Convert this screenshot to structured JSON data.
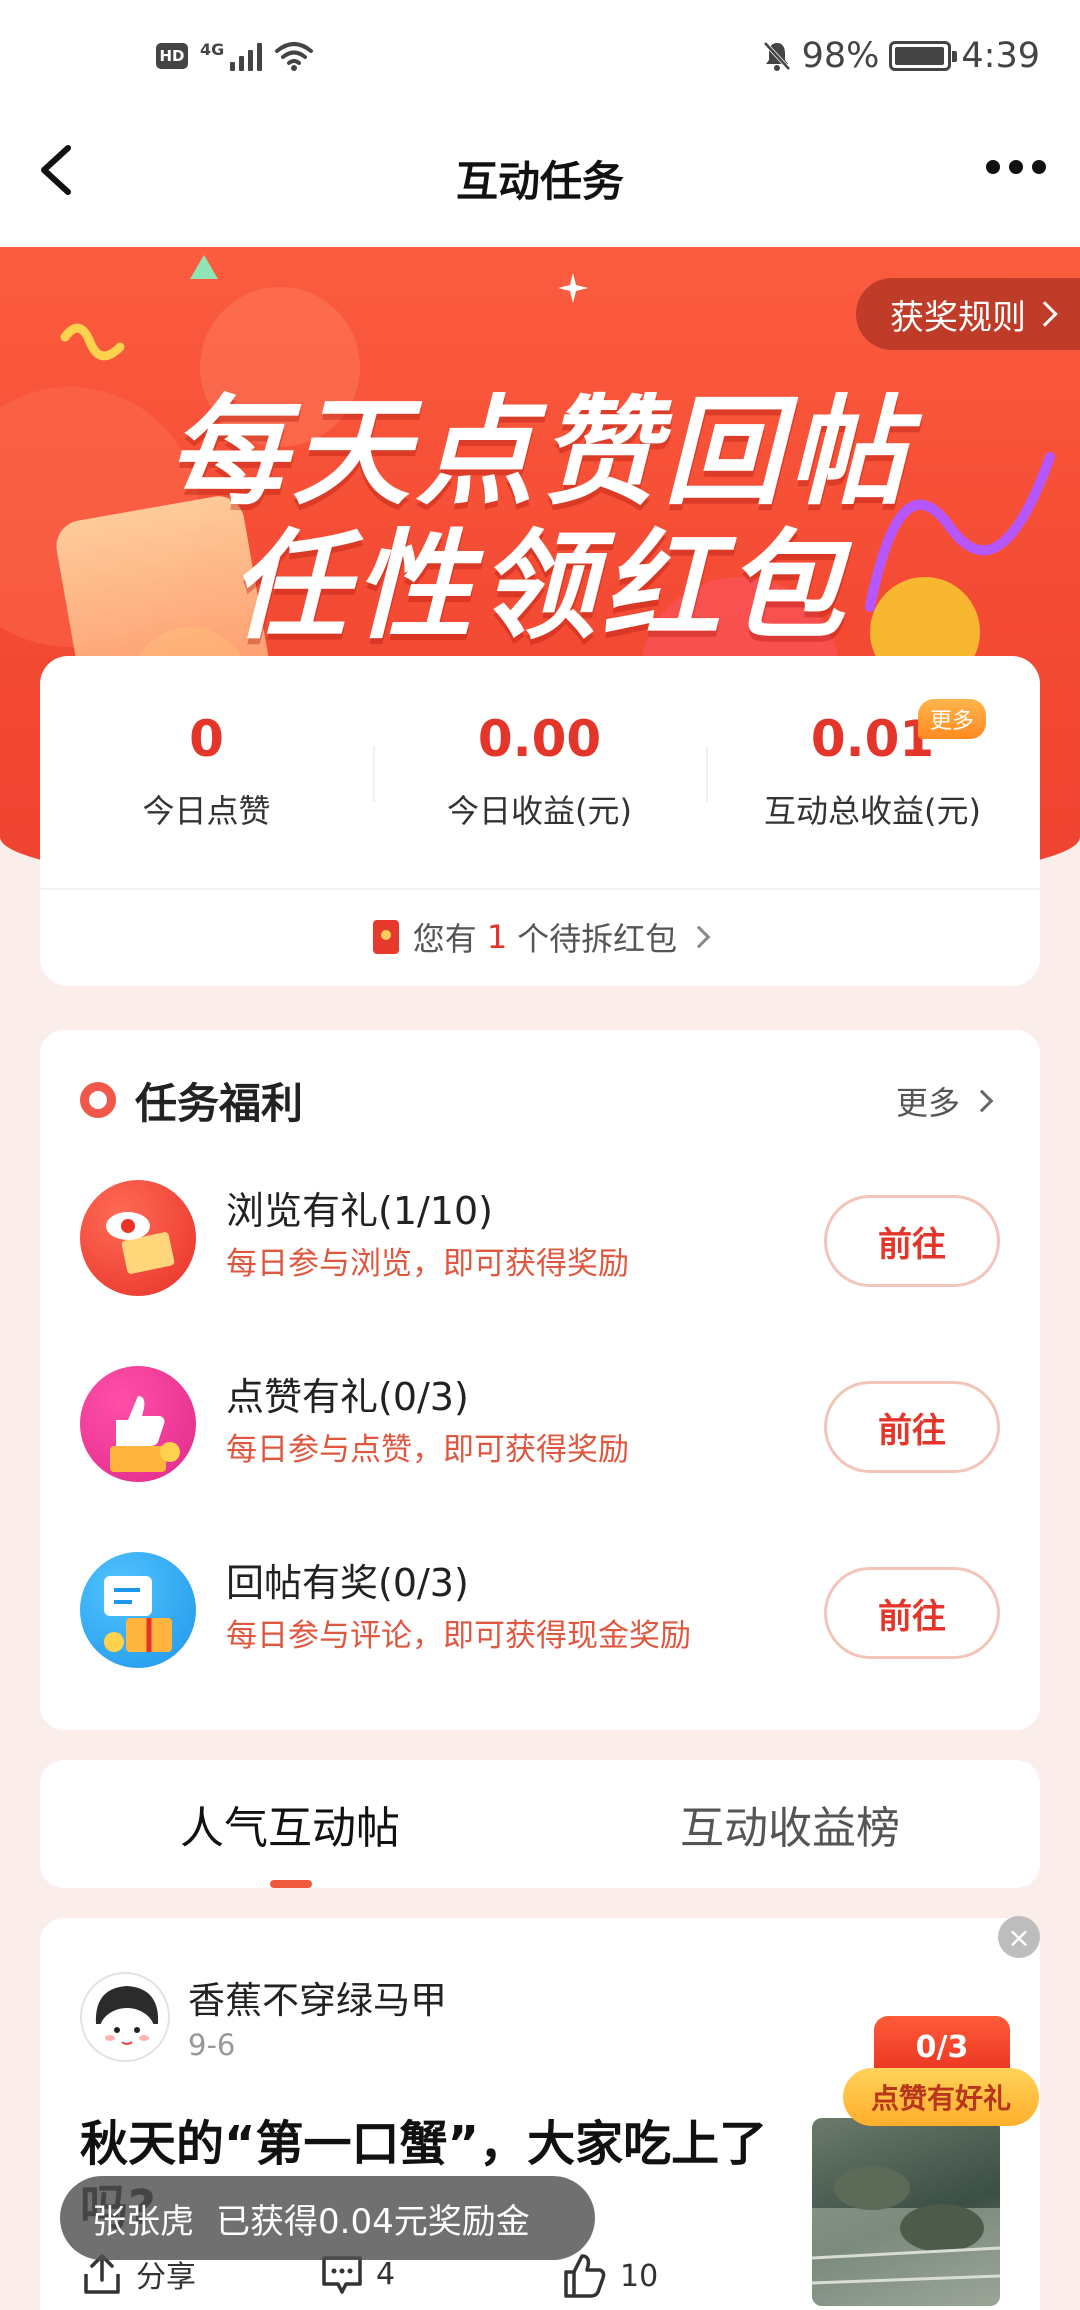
{
  "status_bar": {
    "hd": "HD",
    "network": "4G",
    "battery_percent": "98%",
    "time": "4:39"
  },
  "header": {
    "title": "互动任务"
  },
  "banner": {
    "rule_label": "获奖规则",
    "headline_line1": "每天点赞回帖",
    "headline_line2": "任性领红包"
  },
  "stats": {
    "items": [
      {
        "value": "0",
        "label": "今日点赞"
      },
      {
        "value": "0.00",
        "label": "今日收益(元)"
      },
      {
        "value": "0.01",
        "label": "互动总收益(元)"
      }
    ],
    "more_badge": "更多",
    "pending_prefix": "您有",
    "pending_count": "1",
    "pending_suffix": "个待拆红包"
  },
  "tasks": {
    "title": "任务福利",
    "more_label": "更多",
    "items": [
      {
        "name": "浏览有礼(1/10)",
        "desc": "每日参与浏览，即可获得奖励",
        "button": "前往",
        "icon": "eye-book-icon"
      },
      {
        "name": "点赞有礼(0/3)",
        "desc": "每日参与点赞，即可获得奖励",
        "button": "前往",
        "icon": "thumbs-up-gift-icon"
      },
      {
        "name": "回帖有奖(0/3)",
        "desc": "每日参与评论，即可获得现金奖励",
        "button": "前往",
        "icon": "comment-gift-icon"
      }
    ]
  },
  "tabs": {
    "items": [
      {
        "label": "人气互动帖",
        "active": true
      },
      {
        "label": "互动收益榜",
        "active": false
      }
    ]
  },
  "post": {
    "author": "香蕉不穿绿马甲",
    "date": "9-6",
    "title": "秋天的“第一口蟹”，大家吃上了吗?",
    "promo_count": "0/3",
    "promo_label": "点赞有好礼",
    "toast_name": "张张虎",
    "toast_text": "已获得0.04元奖励金",
    "share_label": "分享",
    "comment_count": "4",
    "like_count": "10"
  },
  "colors": {
    "accent": "#e4352b",
    "banner": "#f44b34",
    "background": "#fbeeea"
  }
}
